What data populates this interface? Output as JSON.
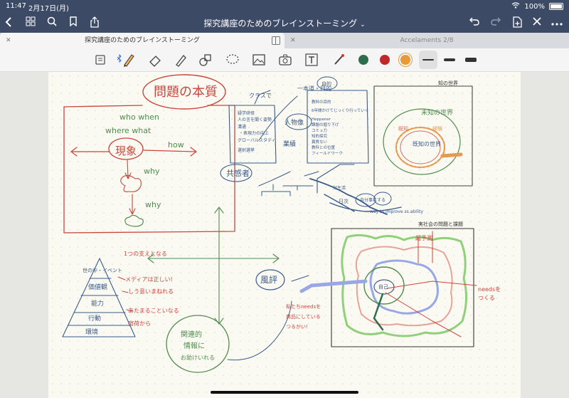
{
  "status": {
    "time": "11:47",
    "date": "2月17日(月)",
    "battery": "100%"
  },
  "nav": {
    "title": "探究講座のためのブレインストーミング"
  },
  "tabs": [
    {
      "label": "探究講座のためのブレインストーミング"
    },
    {
      "label": "Accelaments 2/8"
    }
  ],
  "toolbar": {
    "colors": [
      "#2e6e4e",
      "#c0282a",
      "#e89a3a"
    ]
  },
  "note": {
    "red_box": {
      "title": "問題の本質",
      "who_when": "who when",
      "where_what": "where what",
      "center": "現象",
      "how": "how",
      "why1": "why",
      "why2": "why"
    },
    "blue_list": {
      "header": "クラスで",
      "items": [
        "疑学研修",
        "人の言を聞く姿勢",
        "溝通",
        "・表現力の向上",
        "グローバルスタディ",
        "選択選挙"
      ]
    },
    "blue_labels": [
      "人物像",
      "業績",
      "共感者",
      "一本道・目的",
      "自的",
      "日次",
      "自分事にする",
      "対生活",
      "way to improve ss.ability"
    ],
    "right_list": {
      "items": [
        "教科の目的",
        "6年間かけてじっくり行っていく",
        "Heppener",
        "課題の掘り下げ",
        "コミュ力",
        "知的探究",
        "異質ない",
        "教科との位置",
        "フィールドワーク"
      ]
    },
    "top_right": {
      "label": "知の世界",
      "inner": "未知の世界",
      "ring1": "既知",
      "ring2": "経験",
      "center": "既知の世界"
    },
    "pyramid": {
      "annotation": "1つの支えとなる",
      "levels": [
        "世の中・イベント",
        "価値観",
        "能力",
        "行動",
        "環境"
      ],
      "notes": [
        "メディアは正しい!",
        "しう意いまねれる",
        "あたまることいなる",
        "宿荷から"
      ]
    },
    "green_circle": {
      "text": [
        "関連的",
        "情報に",
        "お助けいれる"
      ]
    },
    "lower_right": {
      "label": "実社会の問題と課題",
      "side": "超予測",
      "center": "自己",
      "blue_circle": "風評",
      "red_note": [
        "私たちneedsを",
        "商品にしている",
        "つるかい!"
      ],
      "right_note": [
        "needsを",
        "つくる"
      ]
    }
  }
}
